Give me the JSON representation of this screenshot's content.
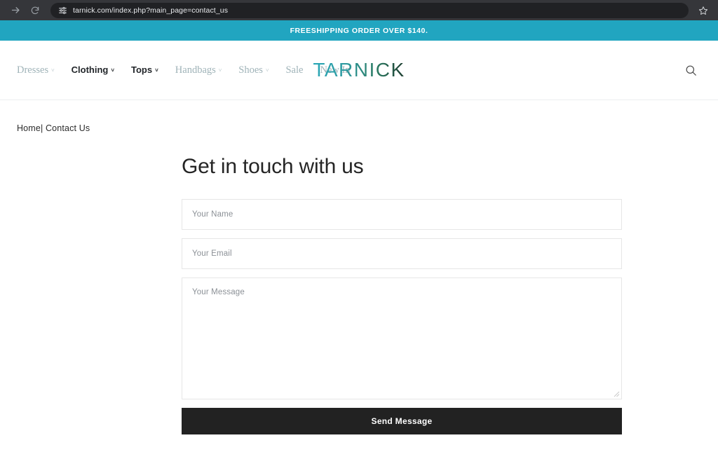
{
  "browser": {
    "url": "tarnick.com/index.php?main_page=contact_us",
    "forward_icon": "forward-arrow-icon",
    "reload_icon": "reload-icon",
    "site_settings_icon": "tune-sliders-icon",
    "bookmark_icon": "star-icon"
  },
  "announcement": {
    "text": "FREESHIPPING ORDER OVER $140.",
    "bg_color": "#21a5c0",
    "text_color": "#ffffff"
  },
  "header": {
    "logo": "TARNICK",
    "logo_gradient_from": "#2aa8b8",
    "logo_gradient_to": "#1c3b2e",
    "search_icon": "search-icon",
    "nav": [
      {
        "label": "Dresses",
        "has_caret": true,
        "caret": "˅",
        "style": "fancy"
      },
      {
        "label": "Clothing",
        "has_caret": true,
        "caret": "˅",
        "style": "plain"
      },
      {
        "label": "Tops",
        "has_caret": true,
        "caret": "˅",
        "style": "plain"
      },
      {
        "label": "Handbags",
        "has_caret": true,
        "caret": "˅",
        "style": "fancy"
      },
      {
        "label": "Shoes",
        "has_caret": true,
        "caret": "˅",
        "style": "fancy"
      },
      {
        "label": "Sale",
        "has_caret": false,
        "caret": "",
        "style": "fancy"
      },
      {
        "label": "New In",
        "has_caret": false,
        "caret": "",
        "style": "fancy"
      }
    ]
  },
  "breadcrumb": {
    "text": "Home| Contact Us"
  },
  "contact": {
    "title": "Get in touch with us",
    "name_placeholder": "Your Name",
    "name_value": "",
    "email_placeholder": "Your Email",
    "email_value": "",
    "message_placeholder": "Your Message",
    "message_value": "",
    "submit_label": "Send Message",
    "submit_bg": "#222222"
  }
}
